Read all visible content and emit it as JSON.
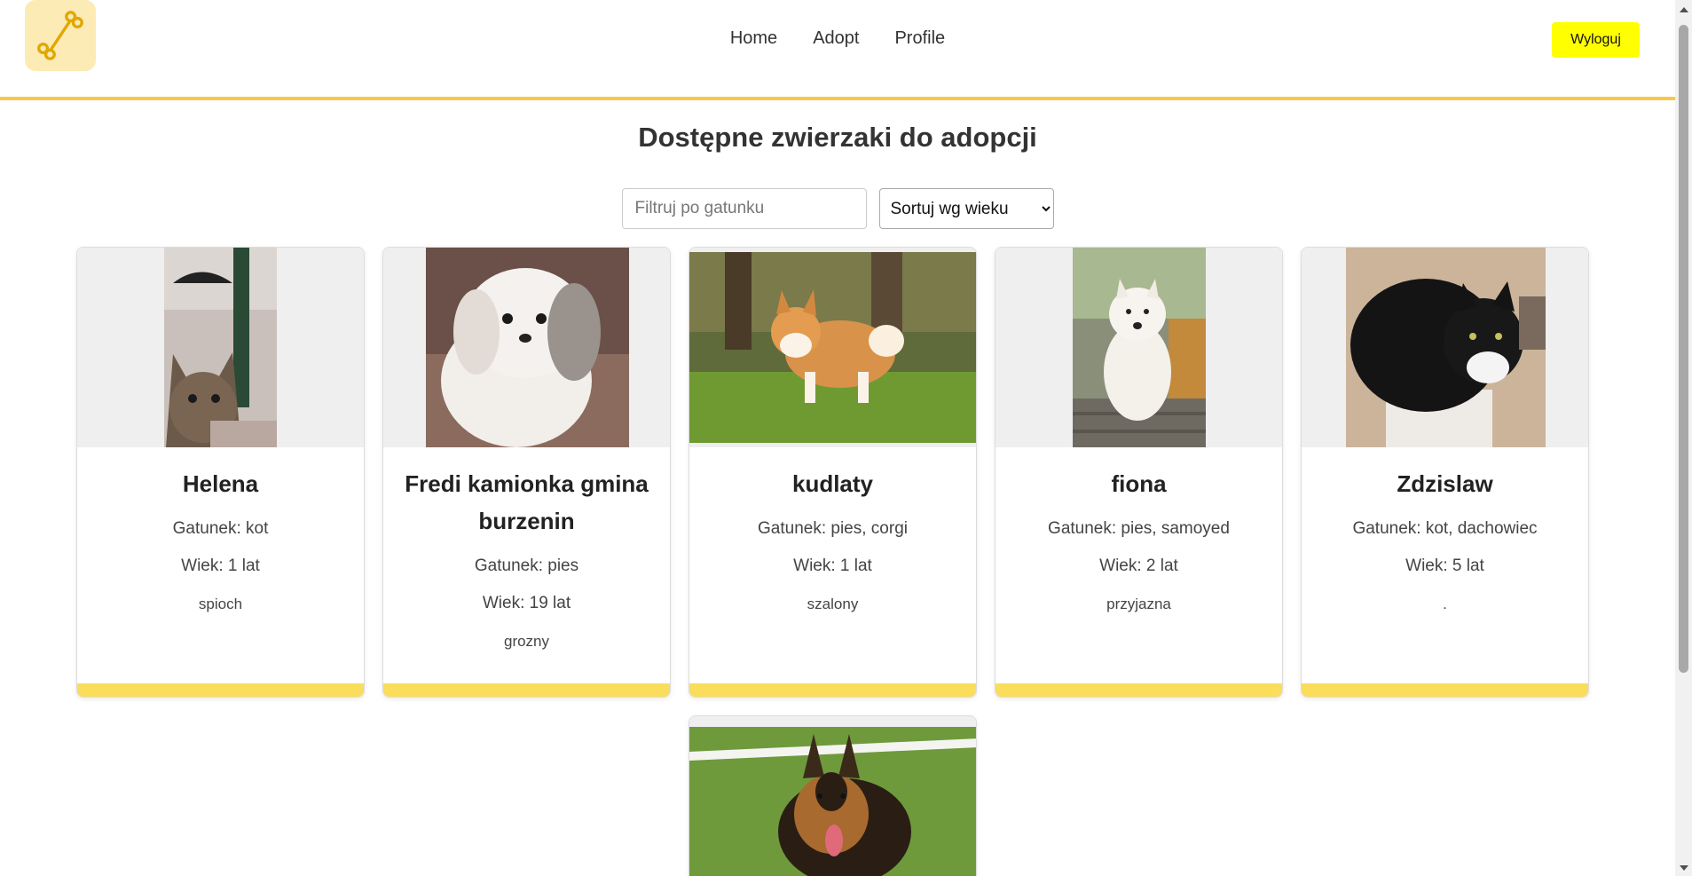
{
  "nav": {
    "home": "Home",
    "adopt": "Adopt",
    "profile": "Profile",
    "logout": "Wyloguj"
  },
  "page": {
    "title": "Dostępne zwierzaki do adopcji"
  },
  "controls": {
    "filter_placeholder": "Filtruj po gatunku",
    "sort_selected": "Sortuj wg wieku"
  },
  "pets": [
    {
      "name": "Helena",
      "species": "Gatunek: kot",
      "age": "Wiek: 1 lat",
      "desc": "spioch"
    },
    {
      "name": "Fredi kamionka gmina burzenin",
      "species": "Gatunek: pies",
      "age": "Wiek: 19 lat",
      "desc": "grozny"
    },
    {
      "name": "kudlaty",
      "species": "Gatunek: pies, corgi",
      "age": "Wiek: 1 lat",
      "desc": "szalony"
    },
    {
      "name": "fiona",
      "species": "Gatunek: pies, samoyed",
      "age": "Wiek: 2 lat",
      "desc": "przyjazna"
    },
    {
      "name": "Zdzislaw",
      "species": "Gatunek: kot, dachowiec",
      "age": "Wiek: 5 lat",
      "desc": "."
    }
  ],
  "colors": {
    "accent": "#f7c948",
    "logout": "#ffff00",
    "card_bar": "#fbdd5c"
  }
}
